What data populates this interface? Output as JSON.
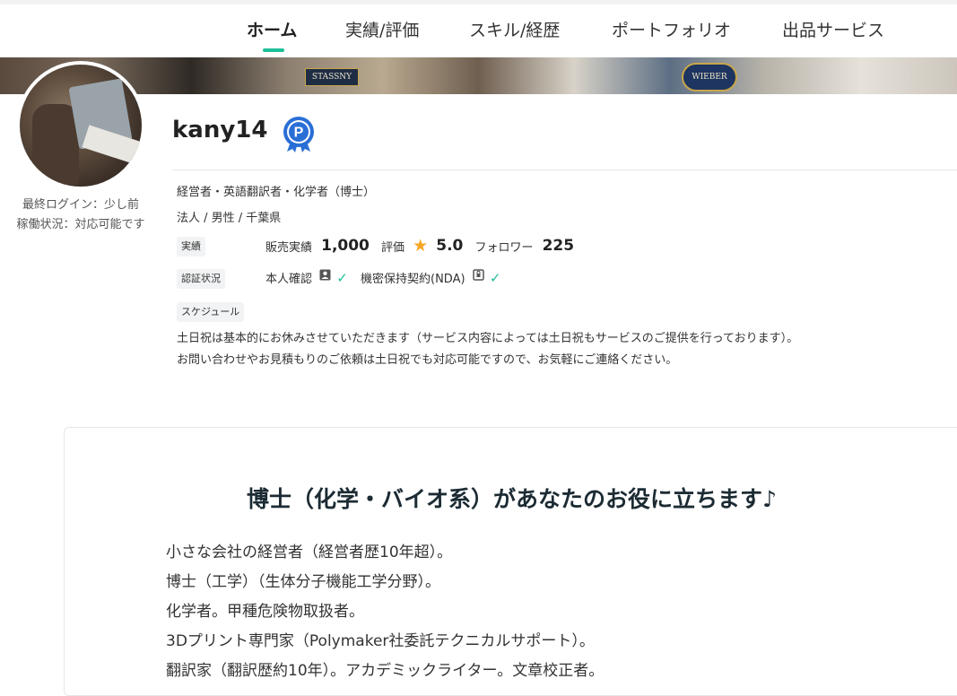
{
  "nav": {
    "items": [
      "ホーム",
      "実績/評価",
      "スキル/経歴",
      "ポートフォリオ",
      "出品サービス"
    ],
    "active_index": 0
  },
  "banner": {
    "sign_left": "STASSNY",
    "sign_right": "WIEBER"
  },
  "profile": {
    "username": "kany14",
    "badge_letter": "P",
    "last_login": "最終ログイン：少し前",
    "availability": "稼働状況：対応可能です",
    "occupation": "経営者・英語翻訳者・化学者（博士）",
    "attributes": "法人 /  男性 /  千葉県"
  },
  "stats": {
    "chip_label": "実績",
    "sales_label": "販売実績",
    "sales_value": "1,000",
    "rating_label": "評価",
    "rating_value": "5.0",
    "followers_label": "フォロワー",
    "followers_value": "225"
  },
  "verification": {
    "chip_label": "認証状況",
    "identity_label": "本人確認",
    "nda_label": "機密保持契約(NDA)"
  },
  "schedule": {
    "chip_label": "スケジュール",
    "lines": [
      "土日祝は基本的にお休みさせていただきます（サービス内容によっては土日祝もサービスのご提供を行っております）。",
      "お問い合わせやお見積もりのご依頼は土日祝でも対応可能ですので、お気軽にご連絡ください。"
    ]
  },
  "intro": {
    "title": "博士（化学・バイオ系）があなたのお役に立ちます♪",
    "lines": [
      "小さな会社の経営者（経営者歴10年超）。",
      "博士（工学）（生体分子機能工学分野）。",
      "化学者。甲種危険物取扱者。",
      "3Dプリント専門家（Polymaker社委託テクニカルサポート）。",
      "翻訳家（翻訳歴約10年）。アカデミックライター。文章校正者。"
    ]
  },
  "colors": {
    "accent": "#1fbf9a",
    "star": "#f5a623",
    "badge": "#2a6fd6"
  }
}
